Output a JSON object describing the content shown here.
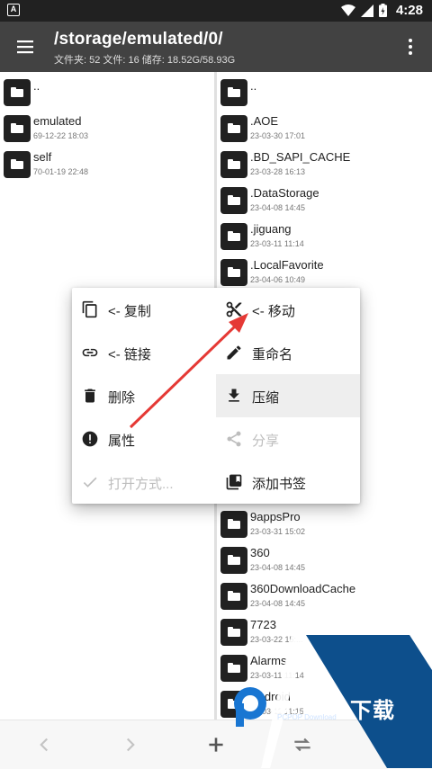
{
  "status": {
    "time": "4:28",
    "left_icon": "A"
  },
  "appbar": {
    "title": "/storage/emulated/0/",
    "subtitle": "文件夹: 52  文件: 16  储存: 18.52G/58.93G"
  },
  "left_pane": [
    {
      "name": "..",
      "date": ""
    },
    {
      "name": "emulated",
      "date": "69-12-22 18:03"
    },
    {
      "name": "self",
      "date": "70-01-19 22:48"
    }
  ],
  "right_pane": [
    {
      "name": "..",
      "date": ""
    },
    {
      "name": ".AOE",
      "date": "23-03-30 17:01"
    },
    {
      "name": ".BD_SAPI_CACHE",
      "date": "23-03-28 16:13"
    },
    {
      "name": ".DataStorage",
      "date": "23-04-08 14:45"
    },
    {
      "name": ".jiguang",
      "date": "23-03-11 11:14"
    },
    {
      "name": ".LocalFavorite",
      "date": "23-04-06 10:49"
    },
    {
      "name": "9appsPro",
      "date": "23-03-31 15:02"
    },
    {
      "name": "360",
      "date": "23-04-08 14:45"
    },
    {
      "name": "360DownloadCache",
      "date": "23-04-08 14:45"
    },
    {
      "name": "7723",
      "date": "23-03-22 15:..."
    },
    {
      "name": "Alarms",
      "date": "23-03-11 11:14"
    },
    {
      "name": "Android",
      "date": "23-03-11 11:15"
    }
  ],
  "menu": {
    "copy": "<- 复制",
    "move": "<- 移动",
    "link": "<- 链接",
    "rename": "重命名",
    "delete": "删除",
    "compress": "压缩",
    "properties": "属性",
    "share": "分享",
    "open_with": "打开方式...",
    "bookmark": "添加书签"
  },
  "watermark": {
    "brand": "PCPOP下载",
    "sub": "PCPOP Download"
  },
  "colors": {
    "appbar": "#424242",
    "statusbar": "#212121",
    "arrow": "#e53935",
    "watermark": "#0d4f8c"
  }
}
